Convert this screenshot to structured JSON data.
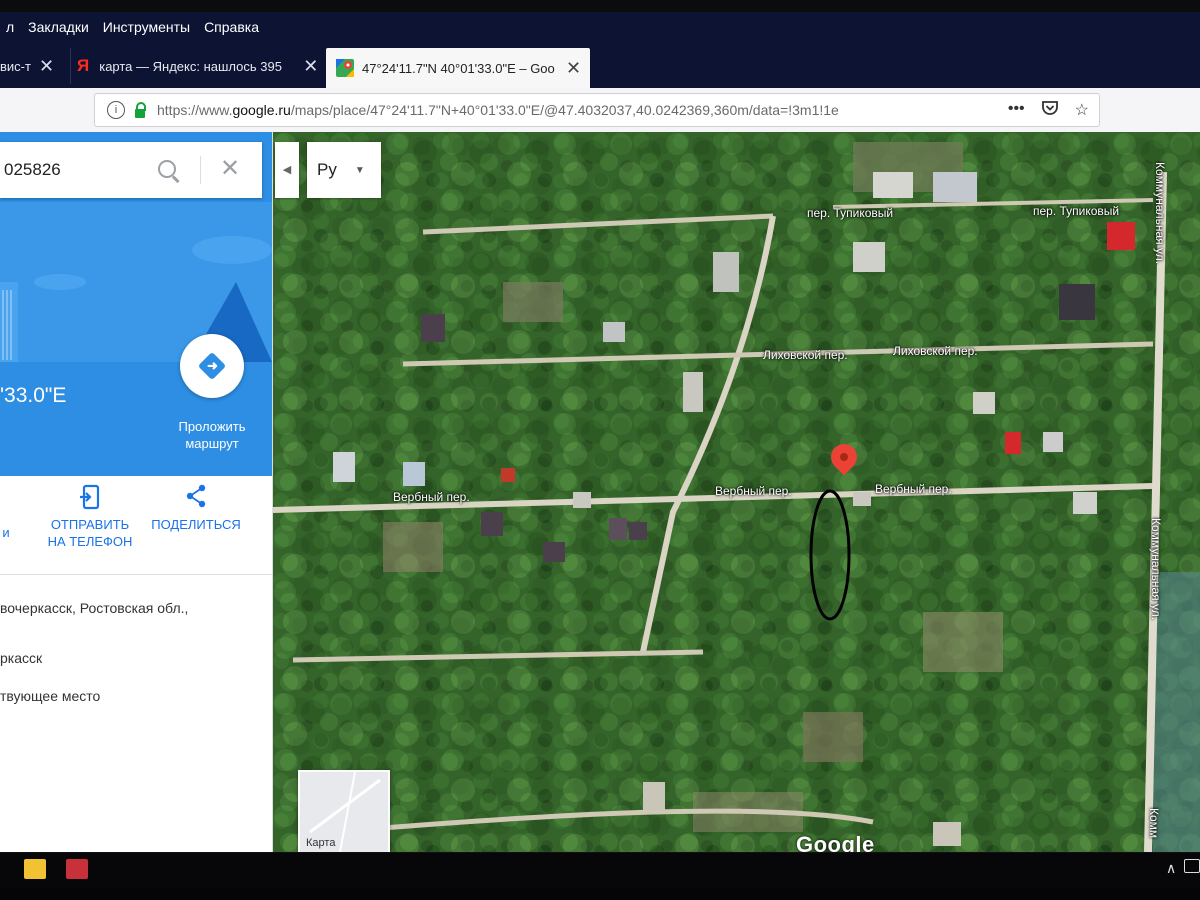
{
  "menu": {
    "items": [
      "л",
      "Закладки",
      "Инструменты",
      "Справка"
    ]
  },
  "tabs": [
    {
      "title": "вис-т",
      "active": false
    },
    {
      "title": "карта — Яндекс: нашлось 395",
      "active": false,
      "icon": "yandex-icon"
    },
    {
      "title": "47°24'11.7\"N 40°01'33.0\"E – Goo",
      "active": true,
      "icon": "google-maps-icon"
    }
  ],
  "newtab_label": "+",
  "address": {
    "url_prefix": "https://www.",
    "url_domain": "google.ru",
    "url_rest": "/maps/place/47°24'11.7\"N+40°01'33.0\"E/@47.4032037,40.0242369,360m/data=!3m1!1e"
  },
  "sidebar": {
    "search_value": "025826",
    "coordinates": "'33.0\"E",
    "route_label": "Проложить маршрут",
    "actions": {
      "left_partial": "и",
      "send_to_phone": "ОТПРАВИТЬ НА ТЕЛЕФОН",
      "share": "ПОДЕЛИТЬСЯ"
    },
    "address_line": "вочеркасск, Ростовская обл.,",
    "city_line": "ркасск",
    "place_line": "твующее место"
  },
  "map": {
    "lang": "Ру",
    "minimap_label": "Карта",
    "logo": "Google",
    "streets": {
      "tupikovy_1": "пер. Тупиковый",
      "tupikovy_2": "пер. Тупиковый",
      "likhovskoy_1": "Лиховской пер.",
      "likhovskoy_2": "Лиховской пер.",
      "verbny_1": "Вербный пер.",
      "verbny_2": "Вербный пер.",
      "verbny_3": "Вербный пер.",
      "kommunalnaya_1": "Коммунальная ул.",
      "kommunalnaya_2": "Коммунальная ул.",
      "kommunalnaya_3": "Комм"
    },
    "colors": {
      "vegetation": "#2f5d25",
      "road": "#d9d4c4",
      "pin": "#ea4335"
    }
  }
}
